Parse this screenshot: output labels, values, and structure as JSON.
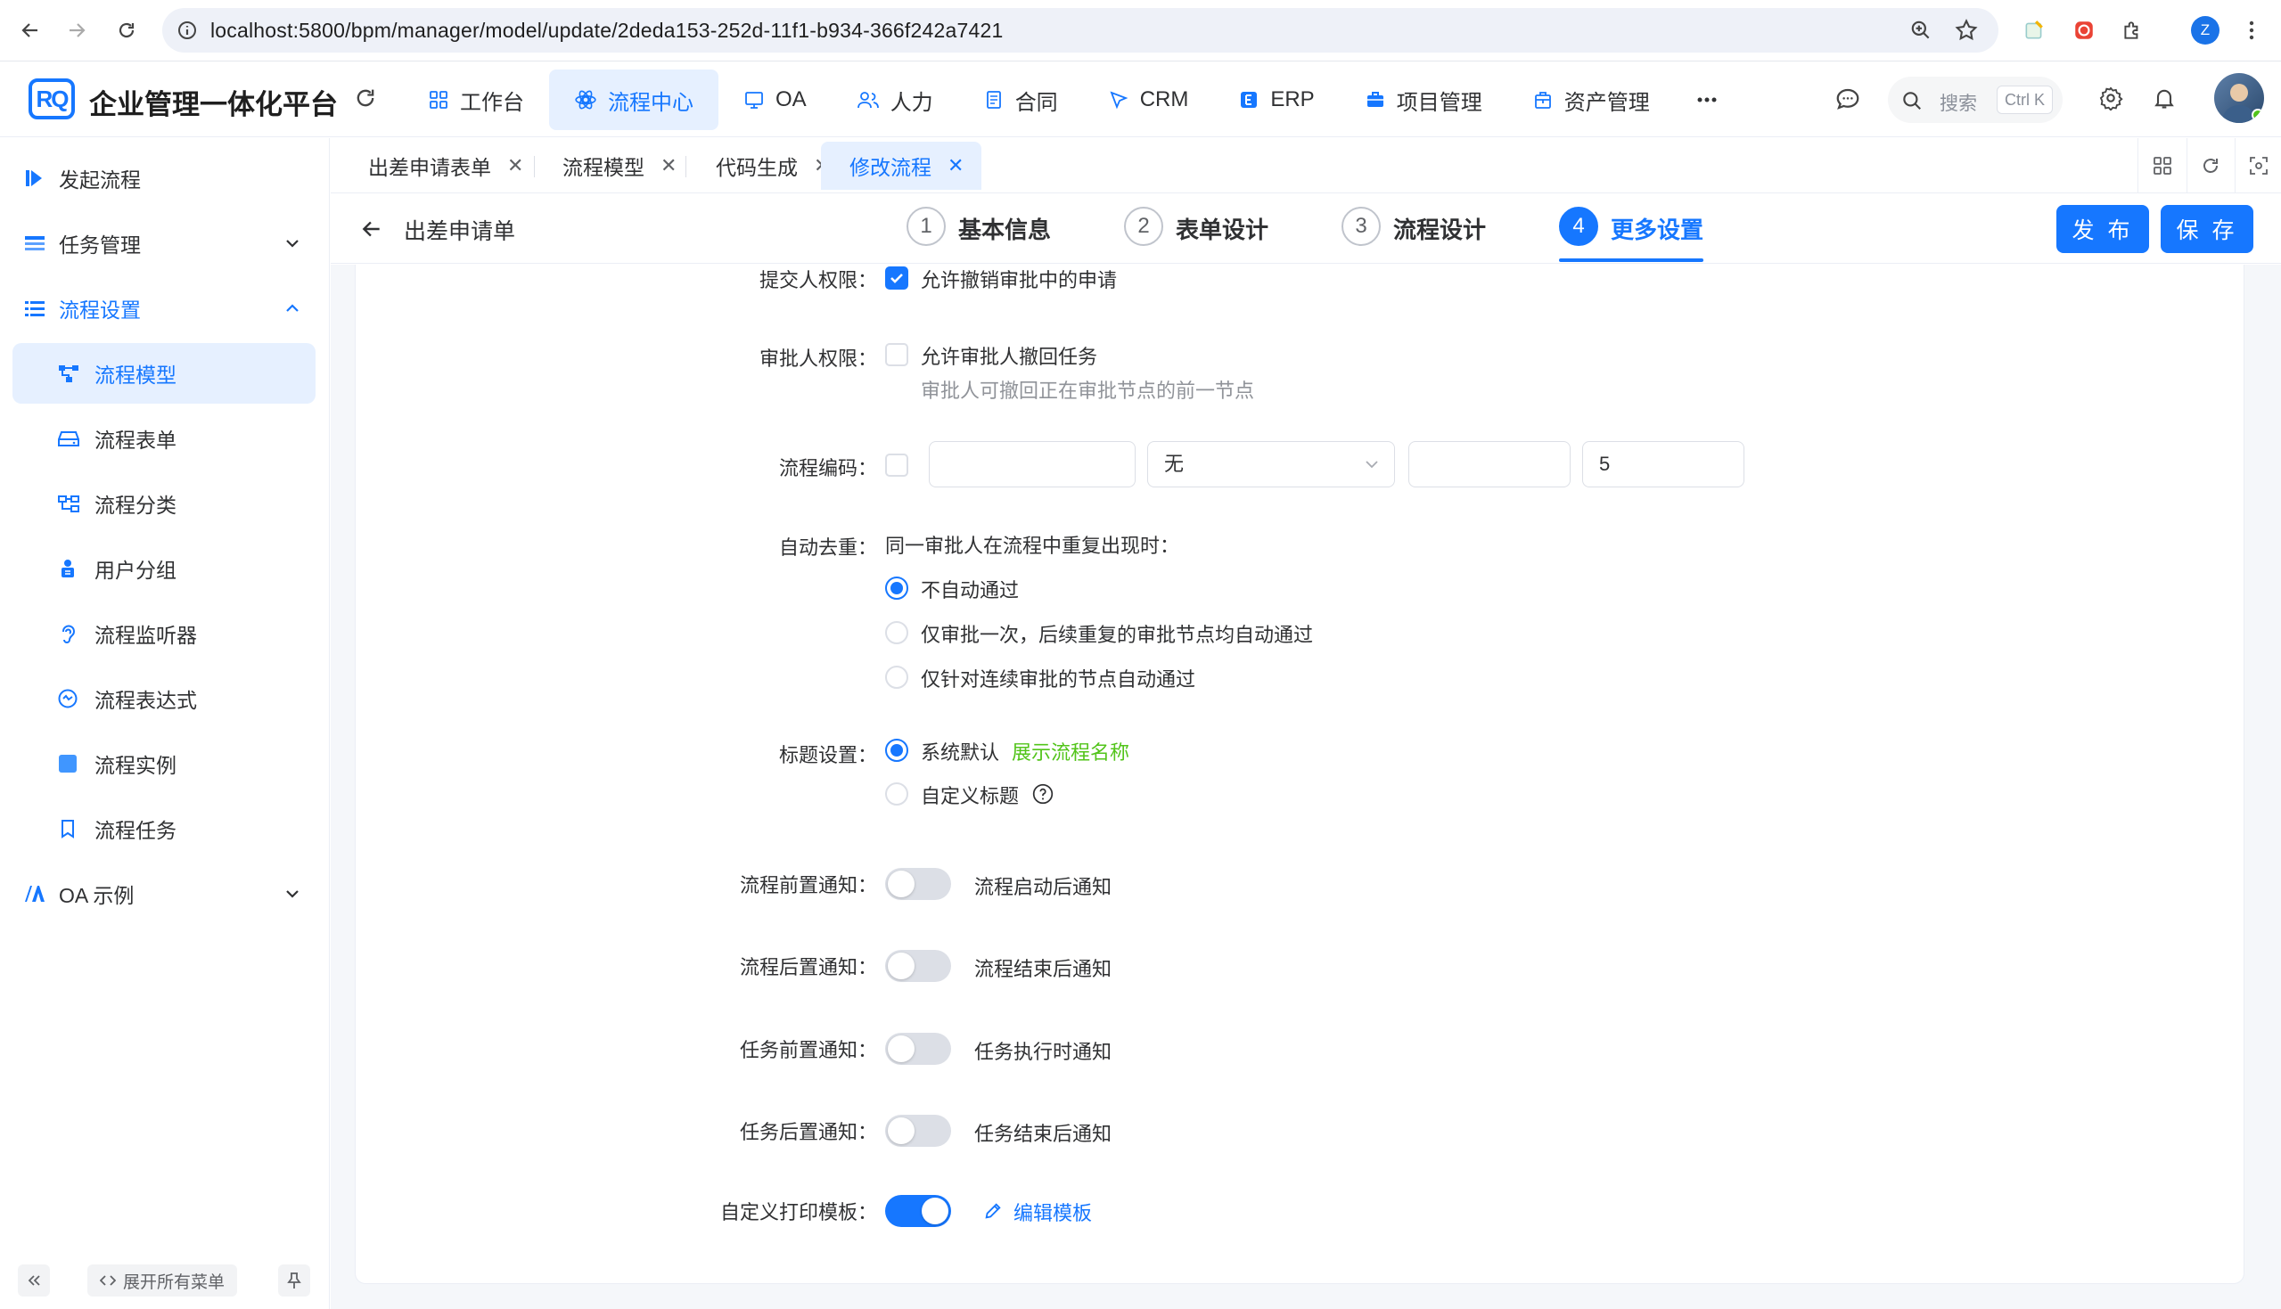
{
  "browser": {
    "url": "localhost:5800/bpm/manager/model/update/2deda153-252d-11f1-b934-366f242a7421",
    "profile_initial": "Z"
  },
  "app": {
    "title": "企业管理一体化平台",
    "logo_text": "RQ",
    "accent": "#1677ff"
  },
  "top_menu": [
    {
      "label": "工作台",
      "icon": "dashboard-icon"
    },
    {
      "label": "流程中心",
      "icon": "flow-icon",
      "active": true
    },
    {
      "label": "OA",
      "icon": "oa-icon"
    },
    {
      "label": "人力",
      "icon": "users-icon"
    },
    {
      "label": "合同",
      "icon": "contract-icon"
    },
    {
      "label": "CRM",
      "icon": "crm-icon"
    },
    {
      "label": "ERP",
      "icon": "erp-icon"
    },
    {
      "label": "项目管理",
      "icon": "briefcase-icon"
    },
    {
      "label": "资产管理",
      "icon": "asset-icon"
    }
  ],
  "header_search": {
    "placeholder": "搜索",
    "shortcut": "Ctrl K"
  },
  "sidebar": {
    "items": [
      {
        "label": "发起流程"
      },
      {
        "label": "任务管理"
      },
      {
        "label": "流程设置"
      },
      {
        "label": "流程模型"
      },
      {
        "label": "流程表单"
      },
      {
        "label": "流程分类"
      },
      {
        "label": "用户分组"
      },
      {
        "label": "流程监听器"
      },
      {
        "label": "流程表达式"
      },
      {
        "label": "流程实例"
      },
      {
        "label": "流程任务"
      },
      {
        "label": "OA 示例"
      }
    ],
    "expand_all": "展开所有菜单"
  },
  "tabs": [
    {
      "label": "出差申请表单"
    },
    {
      "label": "流程模型"
    },
    {
      "label": "代码生成"
    },
    {
      "label": "修改流程",
      "active": true
    }
  ],
  "stepbar": {
    "form_name": "出差申请单",
    "steps": [
      {
        "num": "1",
        "label": "基本信息"
      },
      {
        "num": "2",
        "label": "表单设计"
      },
      {
        "num": "3",
        "label": "流程设计"
      },
      {
        "num": "4",
        "label": "更多设置"
      }
    ],
    "publish_label": "发 布",
    "save_label": "保 存"
  },
  "form": {
    "submitter_perm": {
      "label": "提交人权限：",
      "option": "允许撤销审批中的申请",
      "checked": true
    },
    "approver_perm": {
      "label": "审批人权限：",
      "option": "允许审批人撤回任务",
      "hint": "审批人可撤回正在审批节点的前一节点",
      "checked": false
    },
    "process_code": {
      "label": "流程编码：",
      "select_value": "无",
      "length_value": "5"
    },
    "auto_dedupe": {
      "label": "自动去重：",
      "intro": "同一审批人在流程中重复出现时：",
      "options": [
        "不自动通过",
        "仅审批一次，后续重复的审批节点均自动通过",
        "仅针对连续审批的节点自动通过"
      ],
      "selected": 0
    },
    "title_setting": {
      "label": "标题设置：",
      "default_label": "系统默认",
      "default_extra": "展示流程名称",
      "custom_label": "自定义标题"
    },
    "notifications": [
      {
        "label": "流程前置通知：",
        "text": "流程启动后通知",
        "on": false
      },
      {
        "label": "流程后置通知：",
        "text": "流程结束后通知",
        "on": false
      },
      {
        "label": "任务前置通知：",
        "text": "任务执行时通知",
        "on": false
      },
      {
        "label": "任务后置通知：",
        "text": "任务结束后通知",
        "on": false
      }
    ],
    "print_template": {
      "label": "自定义打印模板：",
      "link": "编辑模板",
      "on": true
    }
  }
}
